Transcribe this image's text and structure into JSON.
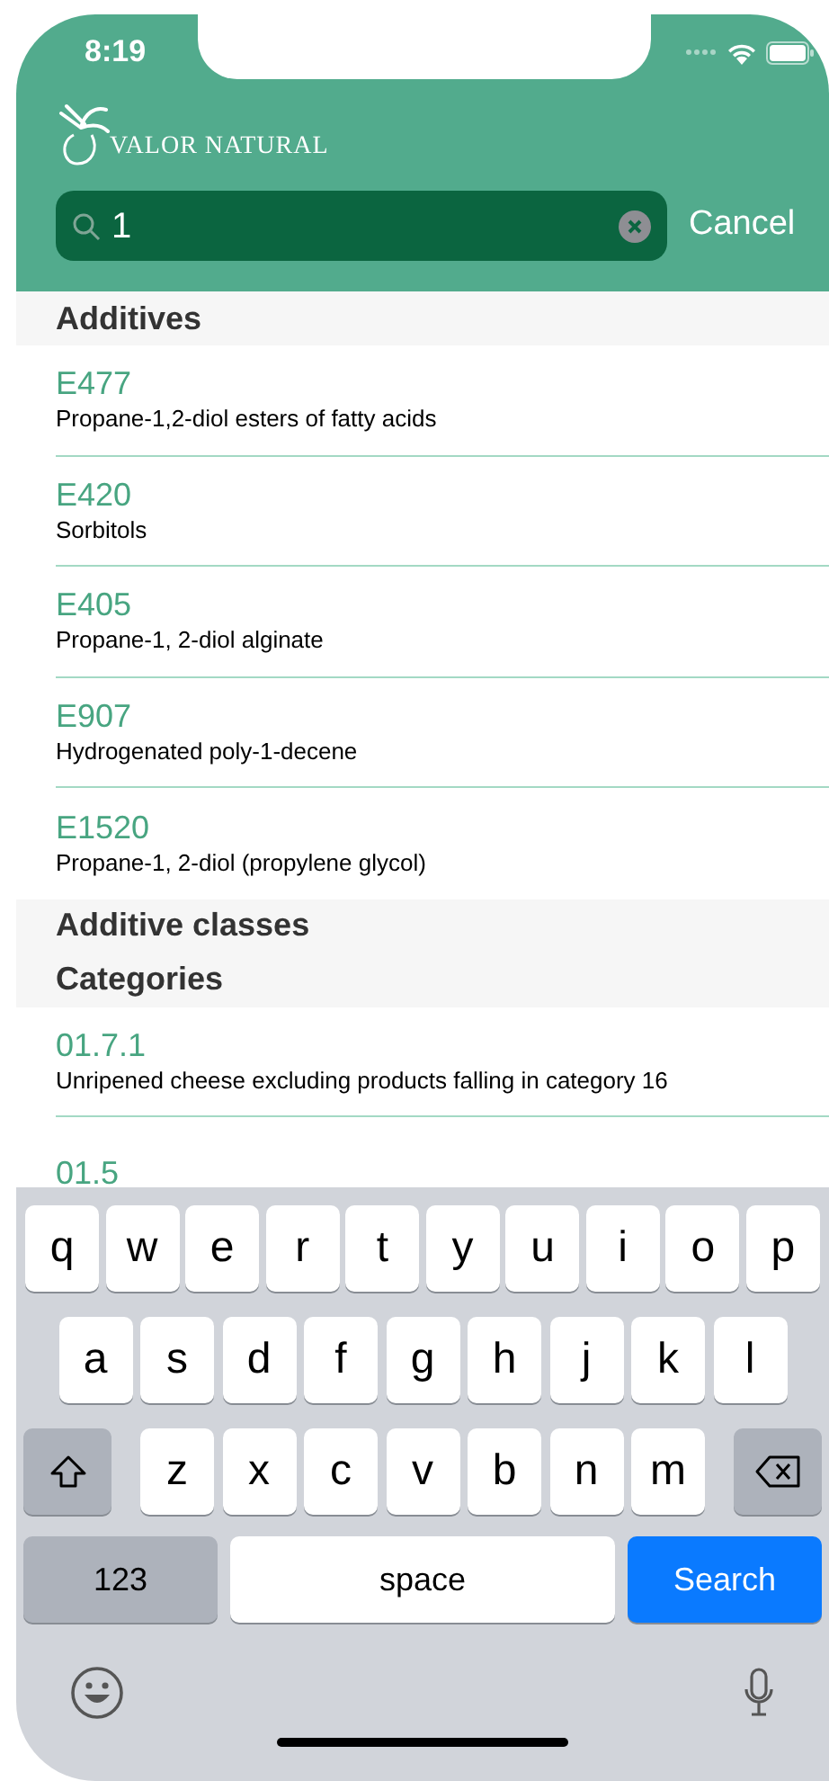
{
  "status_bar": {
    "time": "8:19"
  },
  "header": {
    "logo_text": "VALOR NATURAL",
    "search": {
      "value": "1"
    },
    "cancel": "Cancel"
  },
  "sections": [
    {
      "title": "Additives",
      "items": [
        {
          "code": "E477",
          "name": "Propane-1,2-diol esters of fatty acids"
        },
        {
          "code": "E420",
          "name": "Sorbitols"
        },
        {
          "code": "E405",
          "name": "Propane-1, 2-diol alginate"
        },
        {
          "code": "E907",
          "name": "Hydrogenated poly-1-decene"
        },
        {
          "code": "E1520",
          "name": "Propane-1, 2-diol (propylene glycol)"
        }
      ]
    },
    {
      "title": "Additive classes"
    },
    {
      "title": "Categories",
      "items": [
        {
          "code": "01.7.1",
          "name": "Unripened cheese excluding products falling in category 16"
        },
        {
          "code": "01.5"
        }
      ]
    }
  ],
  "keyboard": {
    "letter_rows": [
      [
        "q",
        "w",
        "e",
        "r",
        "t",
        "y",
        "u",
        "i",
        "o",
        "p"
      ],
      [
        "a",
        "s",
        "d",
        "f",
        "g",
        "h",
        "j",
        "k",
        "l"
      ],
      [
        "z",
        "x",
        "c",
        "v",
        "b",
        "n",
        "m"
      ]
    ],
    "bottom_keys": [
      {
        "kind": "mode",
        "label": "123"
      },
      {
        "kind": "space",
        "label": "space"
      },
      {
        "kind": "action",
        "label": "Search"
      }
    ]
  }
}
